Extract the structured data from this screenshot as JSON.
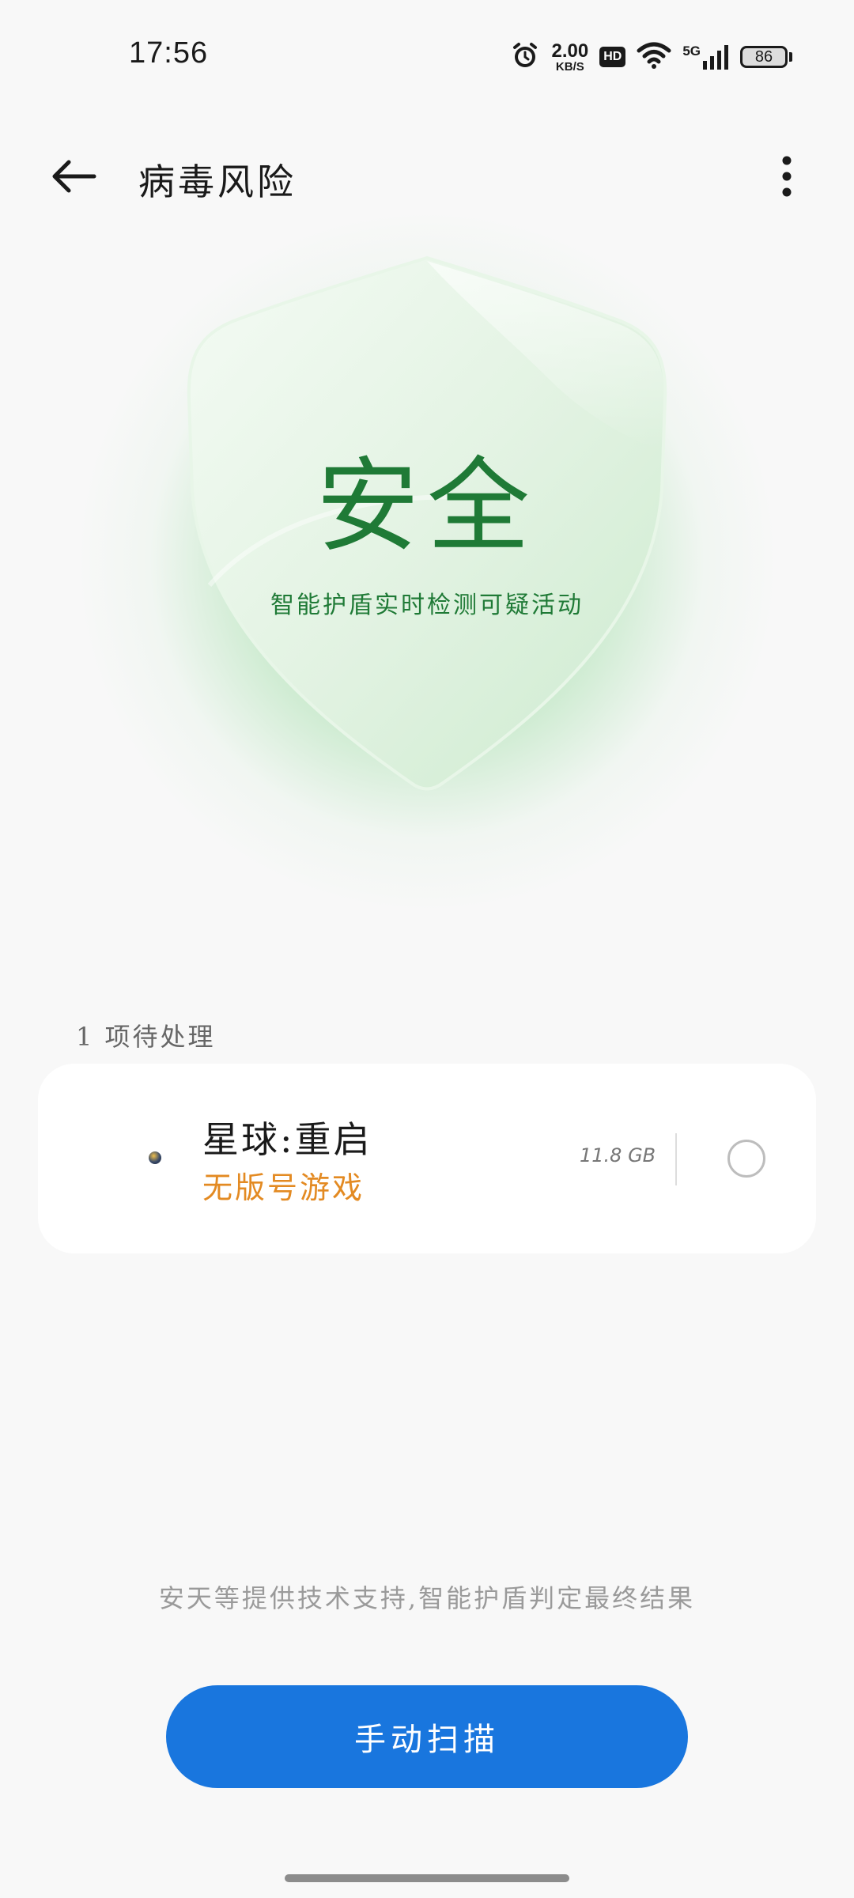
{
  "status_bar": {
    "time": "17:56",
    "net_speed_value": "2.00",
    "net_speed_unit": "KB/S",
    "hd_badge": "HD",
    "signal_label": "5G",
    "battery": "86",
    "icons": [
      "alarm-icon",
      "hd-icon",
      "wifi-icon",
      "signal-icon",
      "battery-icon"
    ]
  },
  "header": {
    "title": "病毒风险",
    "back_icon": "arrow-left-icon",
    "more_icon": "more-vertical-icon"
  },
  "shield": {
    "status": "安全",
    "subtitle": "智能护盾实时检测可疑活动",
    "color": "#1f7a36",
    "glow_color": "#58c86e"
  },
  "pending": {
    "label": "1 项待处理"
  },
  "items": [
    {
      "name": "星球:重启",
      "tag": "无版号游戏",
      "size": "11.8 GB",
      "tag_color": "#e38a22",
      "selected": false
    }
  ],
  "footer": {
    "note": "安天等提供技术支持,智能护盾判定最终结果"
  },
  "actions": {
    "scan_label": "手动扫描",
    "scan_color": "#1976de"
  }
}
